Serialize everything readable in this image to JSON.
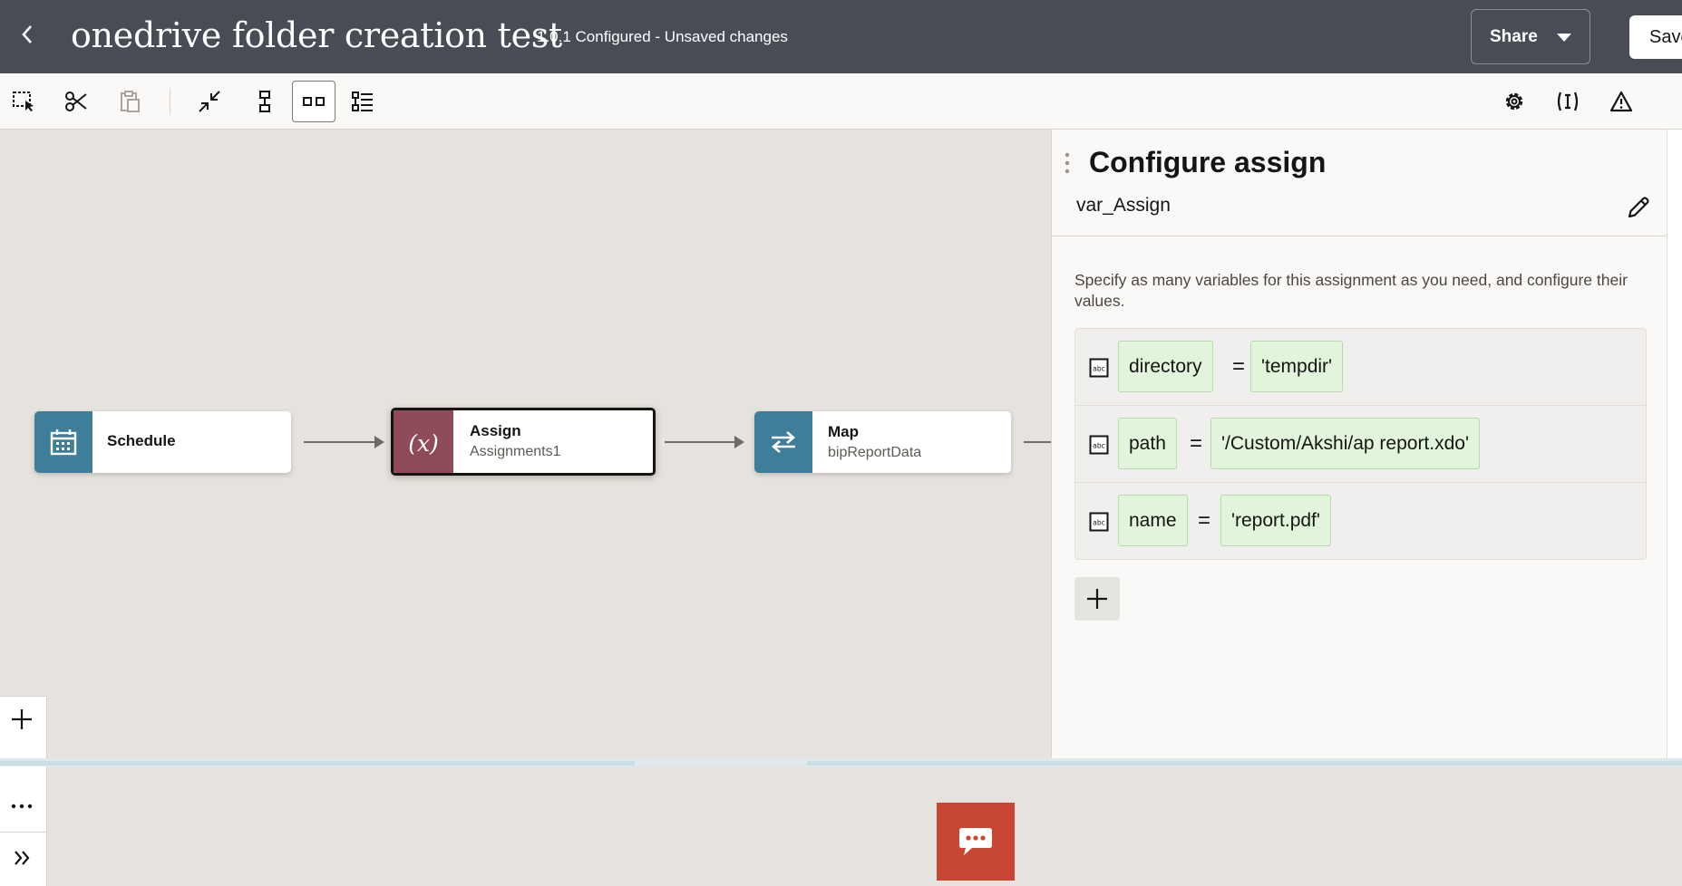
{
  "header": {
    "title": "onedrive folder creation test",
    "status": "1.0.1 Configured - Unsaved changes",
    "share_label": "Share",
    "save_label": "Save"
  },
  "canvas": {
    "nodes": [
      {
        "title": "Schedule",
        "subtitle": "",
        "color": "#3e7e9a"
      },
      {
        "title": "Assign",
        "subtitle": "Assignments1",
        "color": "#8e4c5a",
        "selected": true
      },
      {
        "title": "Map",
        "subtitle": "bipReportData",
        "color": "#3e7e9a"
      }
    ],
    "assign_glyph": "(x)"
  },
  "panel": {
    "title": "Configure assign",
    "name": "var_Assign",
    "description": "Specify as many variables for this assignment as you need, and configure their values.",
    "assignments": [
      {
        "variable": "directory",
        "operator": "=",
        "value": "'tempdir'"
      },
      {
        "variable": "path",
        "operator": "=",
        "value": "'/Custom/Akshi/ap report.xdo'"
      },
      {
        "variable": "name",
        "operator": "=",
        "value": "'report.pdf'"
      }
    ]
  },
  "colors": {
    "header_bg": "#474c55",
    "canvas_bg": "#e6e2dd",
    "chat_button": "#c74634",
    "chip_bg": "#e2f5dc"
  }
}
